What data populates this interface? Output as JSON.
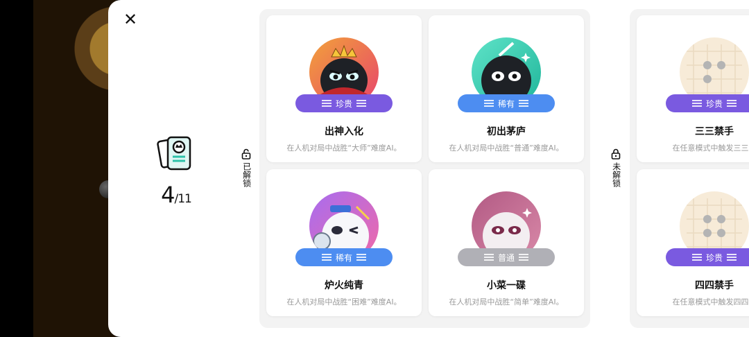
{
  "summary": {
    "unlocked": "4",
    "total": "/11"
  },
  "groups": {
    "unlocked_label": "已解锁",
    "locked_label": "未解锁"
  },
  "unlocked_cards": [
    {
      "title": "出神入化",
      "desc": "在人机对局中战胜“大师”难度AI。",
      "badge": "珍贵",
      "badge_type": "rare",
      "icon": "crowned-black-king-avatar"
    },
    {
      "title": "初出茅庐",
      "desc": "在人机对局中战胜“普通”难度AI。",
      "badge": "稀有",
      "badge_type": "uncommon",
      "icon": "black-ninja-avatar"
    },
    {
      "title": "炉火纯青",
      "desc": "在人机对局中战胜“困难”难度AI。",
      "badge": "稀有",
      "badge_type": "uncommon",
      "icon": "winking-white-ninja-avatar"
    },
    {
      "title": "小菜一碟",
      "desc": "在人机对局中战胜“简单”难度AI。",
      "badge": "普通",
      "badge_type": "common",
      "icon": "white-ninja-avatar"
    }
  ],
  "locked_cards": [
    {
      "title": "三三禁手",
      "desc": "在任意模式中触发三三禁",
      "badge": "珍贵",
      "badge_type": "rare",
      "icon": "go-board-pattern-icon"
    },
    {
      "title": "四四禁手",
      "desc": "在任意模式中触发四四禁",
      "badge": "珍贵",
      "badge_type": "rare",
      "icon": "go-board-pattern-icon"
    }
  ],
  "colors": {
    "rare": "#7a5ae0",
    "uncommon": "#4d8df1",
    "common": "#b0b0b6"
  }
}
